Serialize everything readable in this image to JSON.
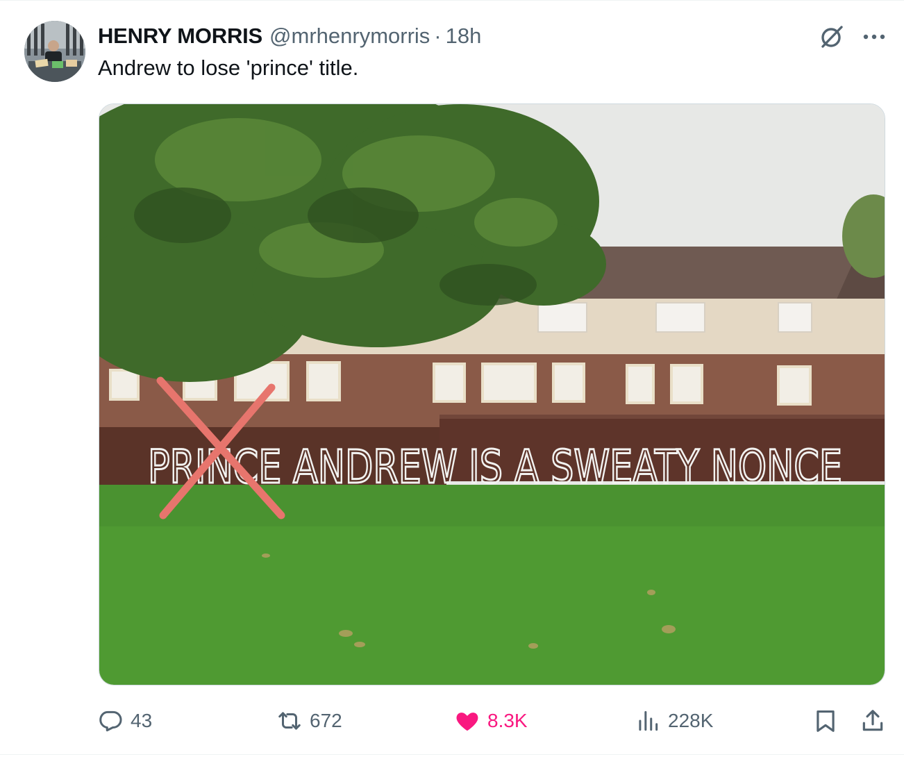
{
  "tweet": {
    "author_name": "HENRY MORRIS",
    "author_handle": "@mrhenrymorris",
    "separator": "·",
    "time": "18h",
    "text": "Andrew to lose 'prince' title."
  },
  "media": {
    "graffiti_text": "PRINCE ANDREW IS A SWEATY NONCE",
    "crossed_out_word": "PRINCE"
  },
  "actions": {
    "replies": "43",
    "reposts": "672",
    "likes": "8.3K",
    "views": "228K"
  },
  "icons": {
    "reply": "reply-icon",
    "repost": "repost-icon",
    "like": "heart-icon",
    "views": "views-icon",
    "bookmark": "bookmark-icon",
    "share": "share-icon",
    "grok": "grok-icon",
    "more": "more-icon"
  },
  "colors": {
    "like_active": "#f91880",
    "secondary_text": "#536471",
    "cross_mark": "#e7756d"
  }
}
